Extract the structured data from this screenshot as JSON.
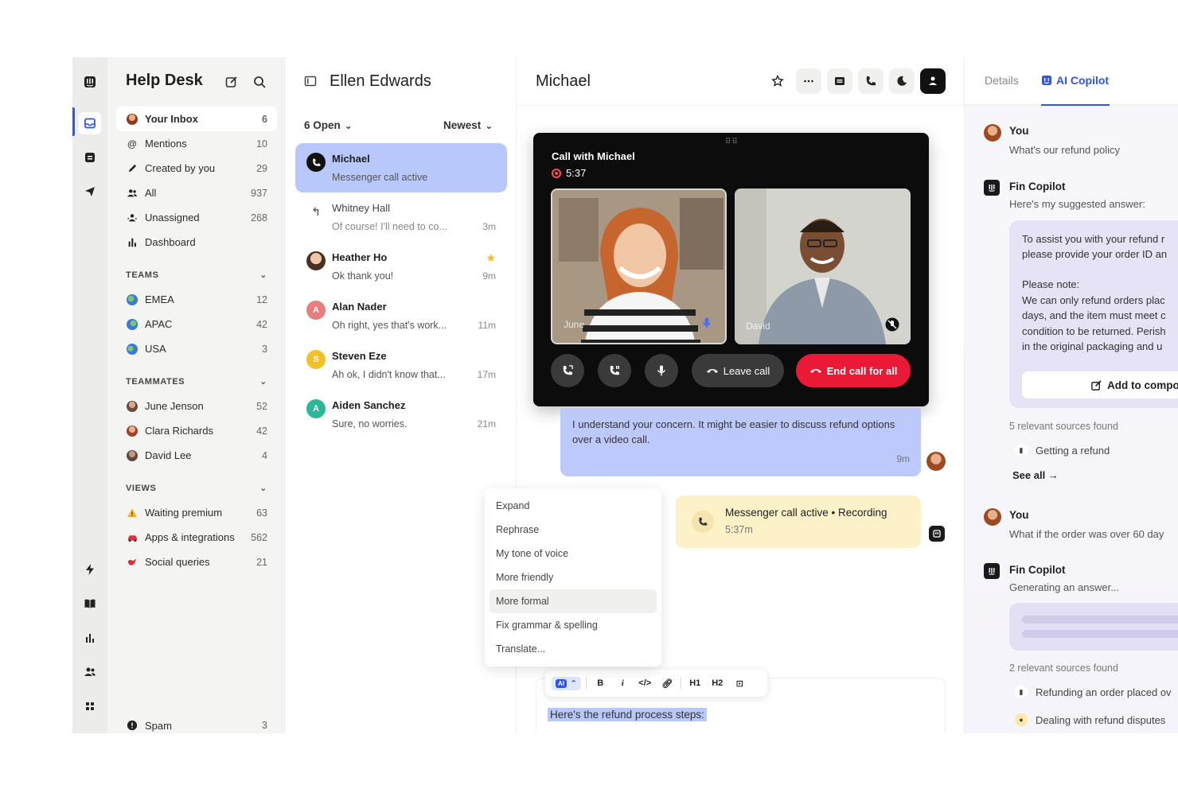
{
  "rail": {
    "icons": [
      "app-logo-icon",
      "inbox-icon",
      "ticket-icon",
      "send-icon",
      "bolt-icon",
      "book-icon",
      "reports-icon",
      "contacts-icon",
      "apps-icon"
    ]
  },
  "sidebar": {
    "title": "Help Desk",
    "items": [
      {
        "label": "Your Inbox",
        "count": "6"
      },
      {
        "label": "Mentions",
        "count": "10"
      },
      {
        "label": "Created by you",
        "count": "29"
      },
      {
        "label": "All",
        "count": "937"
      },
      {
        "label": "Unassigned",
        "count": "268"
      },
      {
        "label": "Dashboard",
        "count": ""
      }
    ],
    "teams_label": "TEAMS",
    "teams": [
      {
        "label": "EMEA",
        "count": "12"
      },
      {
        "label": "APAC",
        "count": "42"
      },
      {
        "label": "USA",
        "count": "3"
      }
    ],
    "teammates_label": "TEAMMATES",
    "teammates": [
      {
        "label": "June Jenson",
        "count": "52"
      },
      {
        "label": "Clara Richards",
        "count": "42"
      },
      {
        "label": "David Lee",
        "count": "4"
      }
    ],
    "views_label": "VIEWS",
    "views": [
      {
        "label": "Waiting premium",
        "count": "63"
      },
      {
        "label": "Apps & integrations",
        "count": "562"
      },
      {
        "label": "Social queries",
        "count": "21"
      }
    ],
    "spam": {
      "label": "Spam",
      "count": "3"
    }
  },
  "convlist": {
    "title": "Ellen Edwards",
    "filter_open": "6 Open",
    "filter_sort": "Newest",
    "conversations": [
      {
        "name": "Michael",
        "preview": "Messenger call active",
        "time": ""
      },
      {
        "name": "Whitney Hall",
        "preview": "Of course! I'll need to co...",
        "time": "3m"
      },
      {
        "name": "Heather Ho",
        "preview": "Ok thank you!",
        "time": "9m"
      },
      {
        "name": "Alan Nader",
        "preview": "Oh right, yes that's work...",
        "time": "11m",
        "initial": "A"
      },
      {
        "name": "Steven Eze",
        "preview": "Ah ok, I didn't know that...",
        "time": "17m",
        "initial": "S"
      },
      {
        "name": "Aiden Sanchez",
        "preview": "Sure, no worries.",
        "time": "21m",
        "initial": "A"
      }
    ]
  },
  "main": {
    "title": "Michael",
    "call": {
      "title": "Call with Michael",
      "timer": "5:37",
      "tile_left_name": "June",
      "tile_right_name": "David",
      "leave_label": "Leave call",
      "end_label": "End call for all"
    },
    "message": {
      "text": "I understand your concern. It might be easier to discuss refund options over a video call.",
      "time": "9m"
    },
    "menu": [
      "Expand",
      "Rephrase",
      "My tone of voice",
      "More friendly",
      "More formal",
      "Fix grammar & spelling",
      "Translate..."
    ],
    "notice": {
      "title": "Messenger call active • Recording",
      "subtitle": "5:37m"
    },
    "toolbar": {
      "ai": "AI",
      "h1": "H1",
      "h2": "H2"
    },
    "composer_text": "Here's the refund process steps:"
  },
  "copilot": {
    "tab_details": "Details",
    "tab_copilot": "AI Copilot",
    "you_label": "You",
    "q1": "What's our refund policy",
    "fin_label": "Fin Copilot",
    "fin_intro": "Here's my suggested answer:",
    "answer_lines": [
      "To assist you with your refund r",
      "please provide your order ID an",
      "",
      "Please note:",
      "We can only refund orders plac",
      "days, and the item must meet c",
      "condition to be returned. Perish",
      "in the original packaging and u"
    ],
    "add_label": "Add to compo",
    "sources_1": "5 relevant sources found",
    "source_1": "Getting a refund",
    "see_all": "See all →",
    "q2": "What if the order was over 60 day",
    "generating": "Generating an answer...",
    "sources_2": "2 relevant sources found",
    "source_2a": "Refunding an order placed ov",
    "source_2b": "Dealing with refund disputes"
  },
  "colors": {
    "accent": "#2f54eb",
    "selected": "#b9c8fb",
    "end_call": "#ea1a37",
    "notice": "#fdf1c8"
  }
}
